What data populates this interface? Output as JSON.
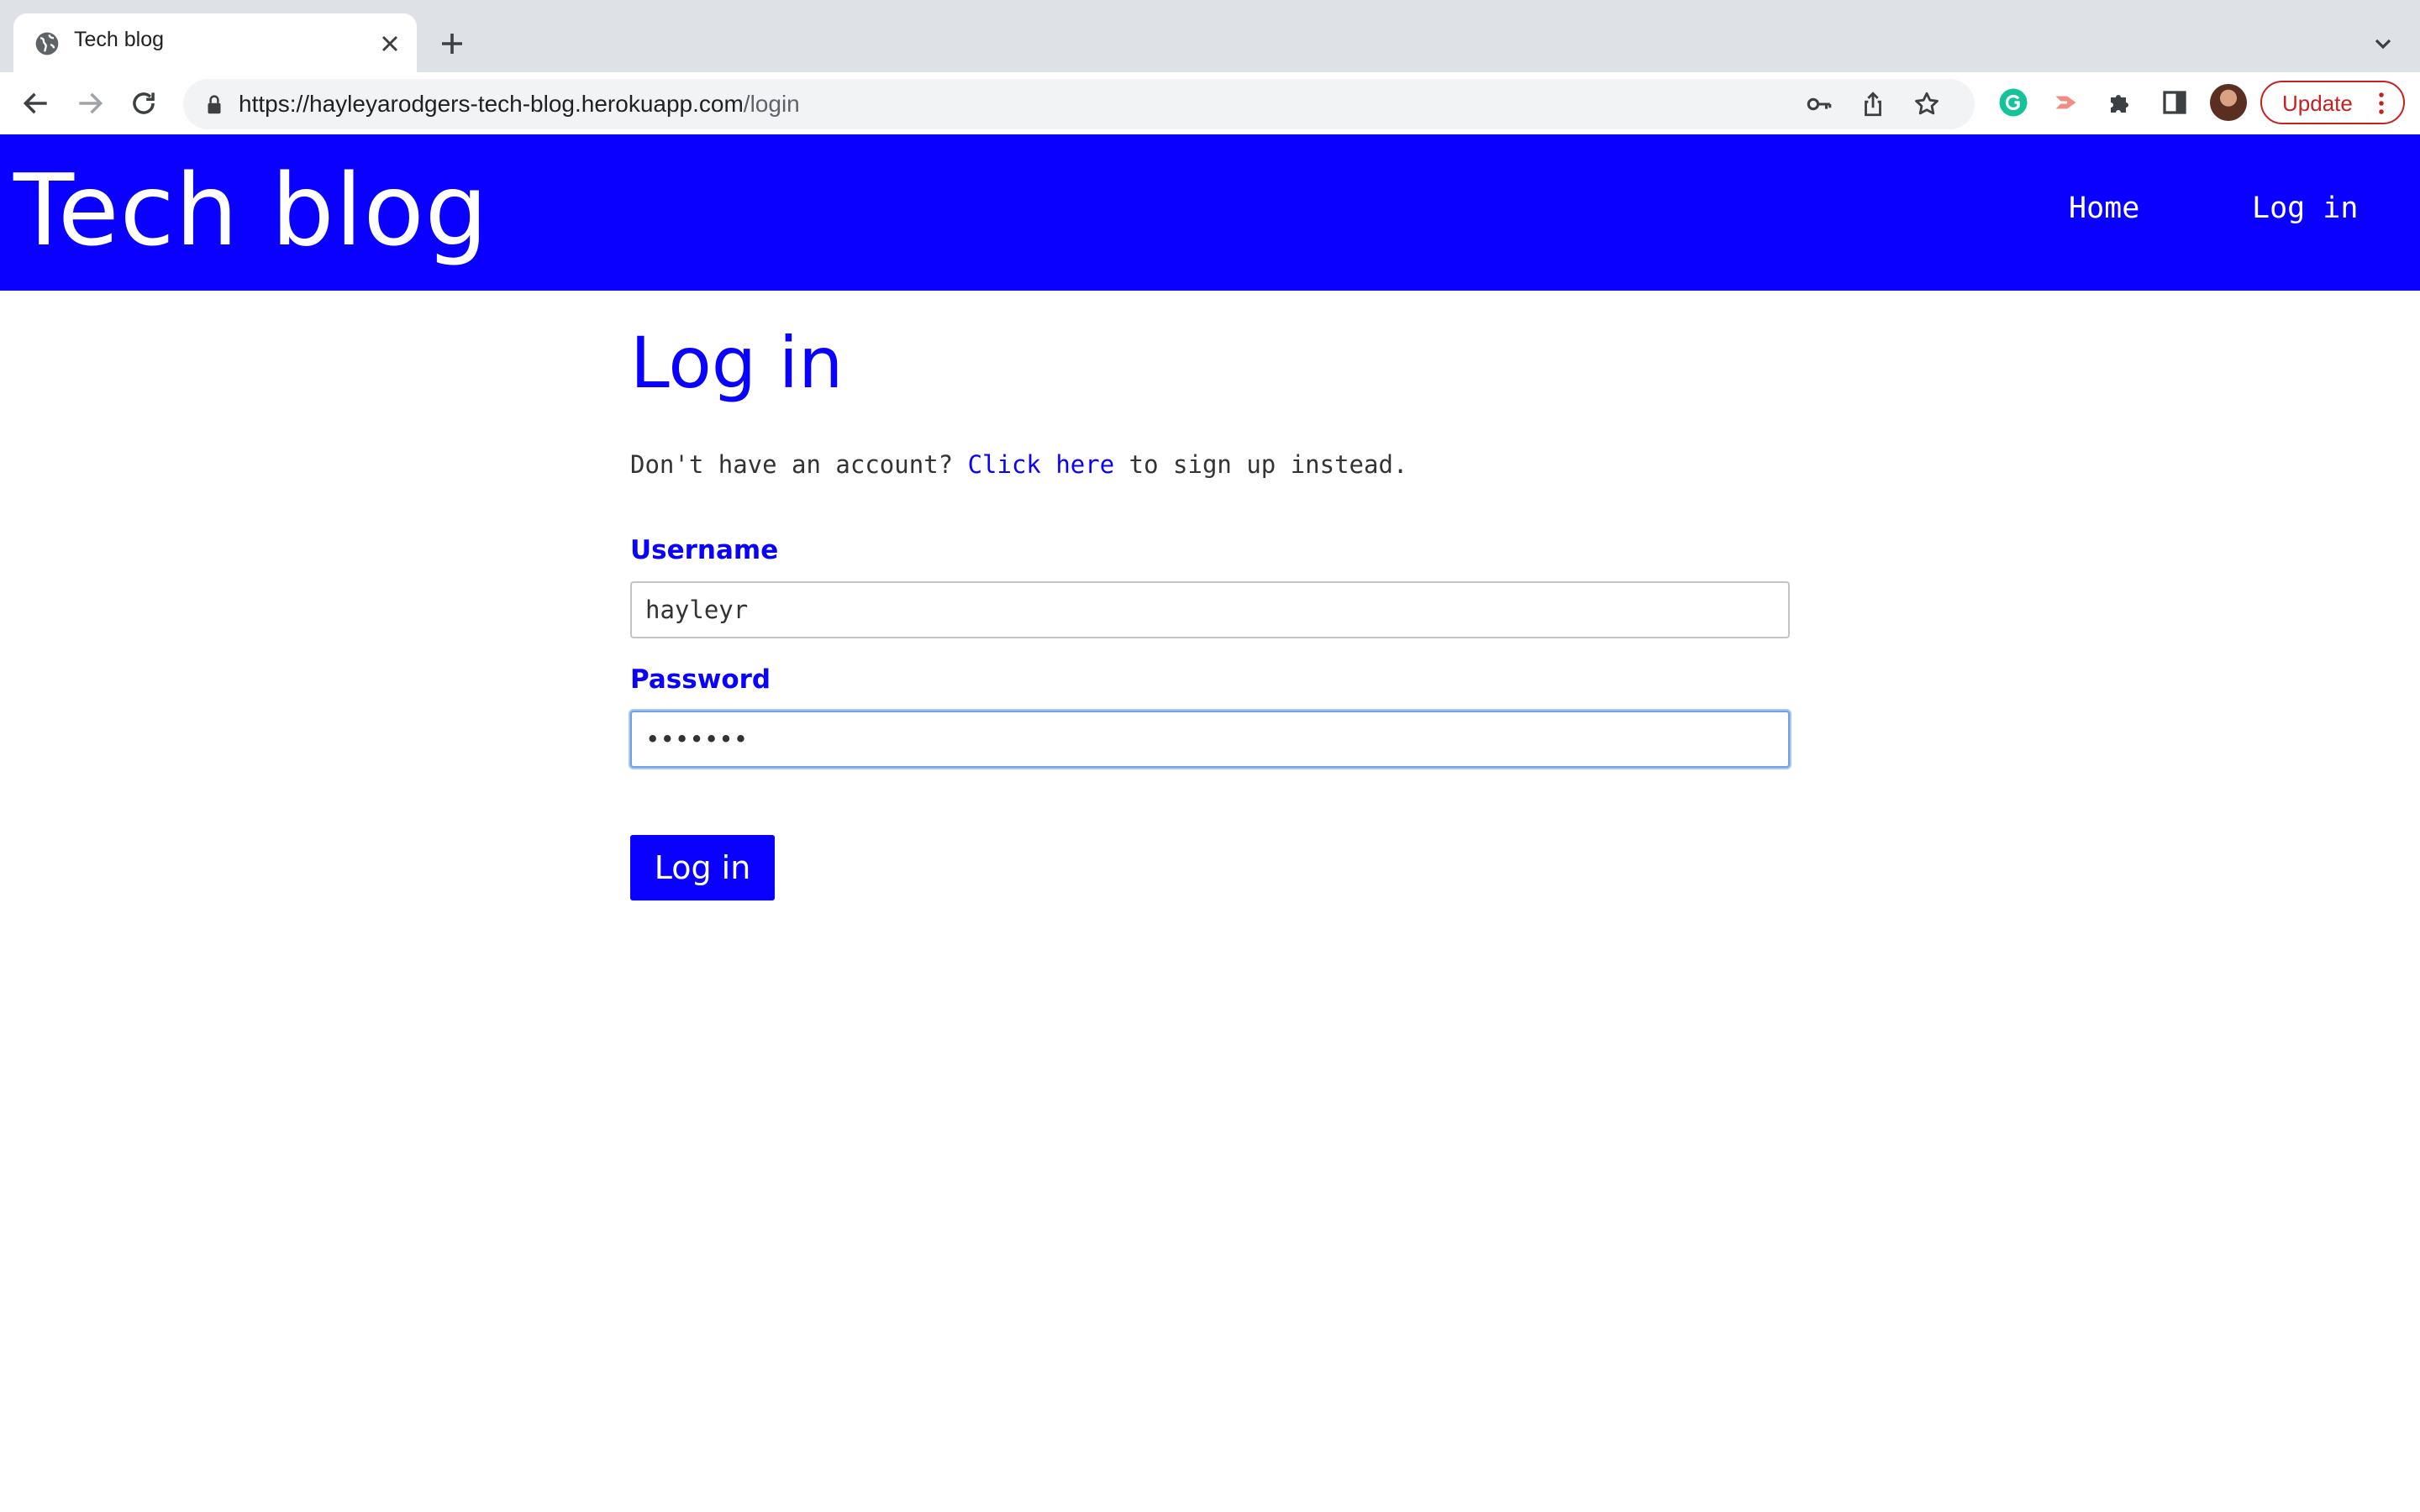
{
  "browser": {
    "tab_title": "Tech blog",
    "url_host": "https://hayleyarodgers-tech-blog.herokuapp.com",
    "url_path": "/login",
    "update_label": "Update",
    "icons": [
      "globe-icon",
      "close-icon",
      "plus-icon",
      "chevron-down-icon",
      "back-arrow-icon",
      "forward-arrow-icon",
      "reload-icon",
      "lock-icon",
      "key-icon",
      "share-icon",
      "star-icon",
      "grammarly-icon",
      "extension-icon",
      "puzzle-icon",
      "side-panel-icon",
      "profile-avatar",
      "more-vert-icon"
    ]
  },
  "site": {
    "title": "Tech blog",
    "nav": {
      "home": "Home",
      "login": "Log in"
    },
    "colors": {
      "brand": "#0a00ff",
      "text": "#333333",
      "background": "#ffffff"
    }
  },
  "login": {
    "heading": "Log in",
    "prompt_before": "Don't have an account? ",
    "prompt_link": "Click here",
    "prompt_after": " to sign up instead.",
    "username_label": "Username",
    "username_value": "hayleyr",
    "password_label": "Password",
    "password_value": "•••••••",
    "submit_label": "Log in"
  }
}
